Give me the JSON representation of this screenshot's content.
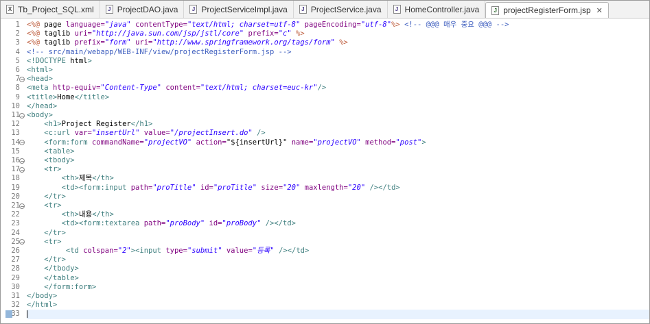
{
  "tabs": [
    {
      "label": "Tb_Project_SQL.xml",
      "icon": "xml-file-icon",
      "kind": "x",
      "active": false
    },
    {
      "label": "ProjectDAO.java",
      "icon": "java-file-icon",
      "kind": "j",
      "active": false
    },
    {
      "label": "ProjectServiceImpl.java",
      "icon": "java-file-icon",
      "kind": "j",
      "active": false
    },
    {
      "label": "ProjectService.java",
      "icon": "java-file-icon",
      "kind": "j",
      "active": false
    },
    {
      "label": "HomeController.java",
      "icon": "java-file-icon",
      "kind": "j",
      "active": false
    },
    {
      "label": "projectRegisterForm.jsp",
      "icon": "jsp-file-icon",
      "kind": "jsp",
      "active": true,
      "close": "✕"
    }
  ],
  "editor": {
    "current_line": 33,
    "lines": [
      {
        "n": "1",
        "fold": false,
        "segs": [
          [
            "d",
            "<%@ "
          ],
          [
            "k",
            "page "
          ],
          [
            "a",
            "language="
          ],
          [
            "v",
            "\"java\""
          ],
          [
            "k",
            " "
          ],
          [
            "a",
            "contentType="
          ],
          [
            "v",
            "\"text/html; charset=utf-8\""
          ],
          [
            "k",
            " "
          ],
          [
            "a",
            "pageEncoding="
          ],
          [
            "v",
            "\"utf-8\""
          ],
          [
            "d",
            "%>"
          ],
          [
            "k",
            " "
          ],
          [
            "c",
            "<!-- @@@ 매우 중요 @@@ -->"
          ]
        ]
      },
      {
        "n": "2",
        "fold": false,
        "segs": [
          [
            "d",
            "<%@ "
          ],
          [
            "k",
            "taglib "
          ],
          [
            "a",
            "uri="
          ],
          [
            "v",
            "\"http://java.sun.com/jsp/jstl/core\""
          ],
          [
            "k",
            " "
          ],
          [
            "a",
            "prefix="
          ],
          [
            "v",
            "\"c\""
          ],
          [
            "k",
            " "
          ],
          [
            "d",
            "%>"
          ]
        ]
      },
      {
        "n": "3",
        "fold": false,
        "segs": [
          [
            "d",
            "<%@ "
          ],
          [
            "k",
            "taglib "
          ],
          [
            "a",
            "prefix="
          ],
          [
            "v",
            "\"form\""
          ],
          [
            "k",
            " "
          ],
          [
            "a",
            "uri="
          ],
          [
            "v",
            "\"http://www.springframework.org/tags/form\""
          ],
          [
            "k",
            " "
          ],
          [
            "d",
            "%>"
          ]
        ]
      },
      {
        "n": "4",
        "fold": false,
        "segs": [
          [
            "c",
            "<!-- src/main/webapp/WEB-INF/view/projectRegisterForm.jsp -->"
          ]
        ]
      },
      {
        "n": "5",
        "fold": false,
        "segs": [
          [
            "t",
            "<!DOCTYPE "
          ],
          [
            "k",
            "html"
          ],
          [
            "t",
            ">"
          ]
        ]
      },
      {
        "n": "6",
        "fold": false,
        "segs": [
          [
            "t",
            "<html>"
          ]
        ]
      },
      {
        "n": "7",
        "fold": true,
        "segs": [
          [
            "t",
            "<head>"
          ]
        ]
      },
      {
        "n": "8",
        "fold": false,
        "segs": [
          [
            "t",
            "<meta "
          ],
          [
            "a",
            "http-equiv="
          ],
          [
            "v",
            "\"Content-Type\""
          ],
          [
            "k",
            " "
          ],
          [
            "a",
            "content="
          ],
          [
            "v",
            "\"text/html; charset=euc-kr\""
          ],
          [
            "t",
            "/>"
          ]
        ]
      },
      {
        "n": "9",
        "fold": false,
        "segs": [
          [
            "t",
            "<title>"
          ],
          [
            "k",
            "Home"
          ],
          [
            "t",
            "</title>"
          ]
        ]
      },
      {
        "n": "10",
        "fold": false,
        "segs": [
          [
            "t",
            "</head>"
          ]
        ]
      },
      {
        "n": "11",
        "fold": true,
        "segs": [
          [
            "t",
            "<body>"
          ]
        ]
      },
      {
        "n": "12",
        "fold": false,
        "segs": [
          [
            "k",
            "    "
          ],
          [
            "t",
            "<h1>"
          ],
          [
            "k",
            "Project Register"
          ],
          [
            "t",
            "</h1>"
          ]
        ]
      },
      {
        "n": "13",
        "fold": false,
        "segs": [
          [
            "k",
            "    "
          ],
          [
            "t",
            "<c:url "
          ],
          [
            "a",
            "var="
          ],
          [
            "v",
            "\"insertUrl\""
          ],
          [
            "k",
            " "
          ],
          [
            "a",
            "value="
          ],
          [
            "v",
            "\"/projectInsert.do\""
          ],
          [
            "k",
            " "
          ],
          [
            "t",
            "/>"
          ]
        ]
      },
      {
        "n": "14",
        "fold": true,
        "segs": [
          [
            "k",
            "    "
          ],
          [
            "t",
            "<form:form "
          ],
          [
            "a",
            "commandName="
          ],
          [
            "v",
            "\"projectVO\""
          ],
          [
            "k",
            " "
          ],
          [
            "a",
            "action="
          ],
          [
            "k",
            "\"${insertUrl}\""
          ],
          [
            "k",
            " "
          ],
          [
            "a",
            "name="
          ],
          [
            "v",
            "\"projectVO\""
          ],
          [
            "k",
            " "
          ],
          [
            "a",
            "method="
          ],
          [
            "v",
            "\"post\""
          ],
          [
            "t",
            ">"
          ]
        ]
      },
      {
        "n": "15",
        "fold": false,
        "segs": [
          [
            "k",
            "    "
          ],
          [
            "t",
            "<table>"
          ]
        ]
      },
      {
        "n": "16",
        "fold": true,
        "segs": [
          [
            "k",
            "    "
          ],
          [
            "t",
            "<tbody>"
          ]
        ]
      },
      {
        "n": "17",
        "fold": true,
        "segs": [
          [
            "k",
            "    "
          ],
          [
            "t",
            "<tr>"
          ]
        ]
      },
      {
        "n": "18",
        "fold": false,
        "segs": [
          [
            "k",
            "        "
          ],
          [
            "t",
            "<th>"
          ],
          [
            "k",
            "제목"
          ],
          [
            "t",
            "</th>"
          ]
        ]
      },
      {
        "n": "19",
        "fold": false,
        "segs": [
          [
            "k",
            "        "
          ],
          [
            "t",
            "<td><form:input "
          ],
          [
            "a",
            "path="
          ],
          [
            "v",
            "\"proTitle\""
          ],
          [
            "k",
            " "
          ],
          [
            "a",
            "id="
          ],
          [
            "v",
            "\"proTitle\""
          ],
          [
            "k",
            " "
          ],
          [
            "a",
            "size="
          ],
          [
            "v",
            "\"20\""
          ],
          [
            "k",
            " "
          ],
          [
            "a",
            "maxlength="
          ],
          [
            "v",
            "\"20\""
          ],
          [
            "k",
            " "
          ],
          [
            "t",
            "/></td>"
          ]
        ]
      },
      {
        "n": "20",
        "fold": false,
        "segs": [
          [
            "k",
            "    "
          ],
          [
            "t",
            "</tr>"
          ]
        ]
      },
      {
        "n": "21",
        "fold": true,
        "segs": [
          [
            "k",
            "    "
          ],
          [
            "t",
            "<tr>"
          ]
        ]
      },
      {
        "n": "22",
        "fold": false,
        "segs": [
          [
            "k",
            "        "
          ],
          [
            "t",
            "<th>"
          ],
          [
            "k",
            "내용"
          ],
          [
            "t",
            "</th>"
          ]
        ]
      },
      {
        "n": "23",
        "fold": false,
        "segs": [
          [
            "k",
            "        "
          ],
          [
            "t",
            "<td><form:textarea "
          ],
          [
            "a",
            "path="
          ],
          [
            "v",
            "\"proBody\""
          ],
          [
            "k",
            " "
          ],
          [
            "a",
            "id="
          ],
          [
            "v",
            "\"proBody\""
          ],
          [
            "k",
            " "
          ],
          [
            "t",
            "/></td>"
          ]
        ]
      },
      {
        "n": "24",
        "fold": false,
        "segs": [
          [
            "k",
            "    "
          ],
          [
            "t",
            "</tr>"
          ]
        ]
      },
      {
        "n": "25",
        "fold": true,
        "segs": [
          [
            "k",
            "    "
          ],
          [
            "t",
            "<tr>"
          ]
        ]
      },
      {
        "n": "26",
        "fold": false,
        "segs": [
          [
            "k",
            "         "
          ],
          [
            "t",
            "<td "
          ],
          [
            "a",
            "colspan="
          ],
          [
            "v",
            "\"2\""
          ],
          [
            "t",
            "><input "
          ],
          [
            "a",
            "type="
          ],
          [
            "v",
            "\"submit\""
          ],
          [
            "k",
            " "
          ],
          [
            "a",
            "value="
          ],
          [
            "v",
            "\"등록\""
          ],
          [
            "k",
            " "
          ],
          [
            "t",
            "/></td>"
          ]
        ]
      },
      {
        "n": "27",
        "fold": false,
        "segs": [
          [
            "k",
            "    "
          ],
          [
            "t",
            "</tr>"
          ]
        ]
      },
      {
        "n": "28",
        "fold": false,
        "segs": [
          [
            "k",
            "    "
          ],
          [
            "t",
            "</tbody>"
          ]
        ]
      },
      {
        "n": "29",
        "fold": false,
        "segs": [
          [
            "k",
            "    "
          ],
          [
            "t",
            "</table>"
          ]
        ]
      },
      {
        "n": "30",
        "fold": false,
        "segs": [
          [
            "k",
            "    "
          ],
          [
            "t",
            "</form:form>"
          ]
        ]
      },
      {
        "n": "31",
        "fold": false,
        "segs": [
          [
            "t",
            "</body>"
          ]
        ]
      },
      {
        "n": "32",
        "fold": false,
        "segs": [
          [
            "t",
            "</html>"
          ]
        ]
      },
      {
        "n": "33",
        "fold": false,
        "segs": []
      }
    ]
  }
}
